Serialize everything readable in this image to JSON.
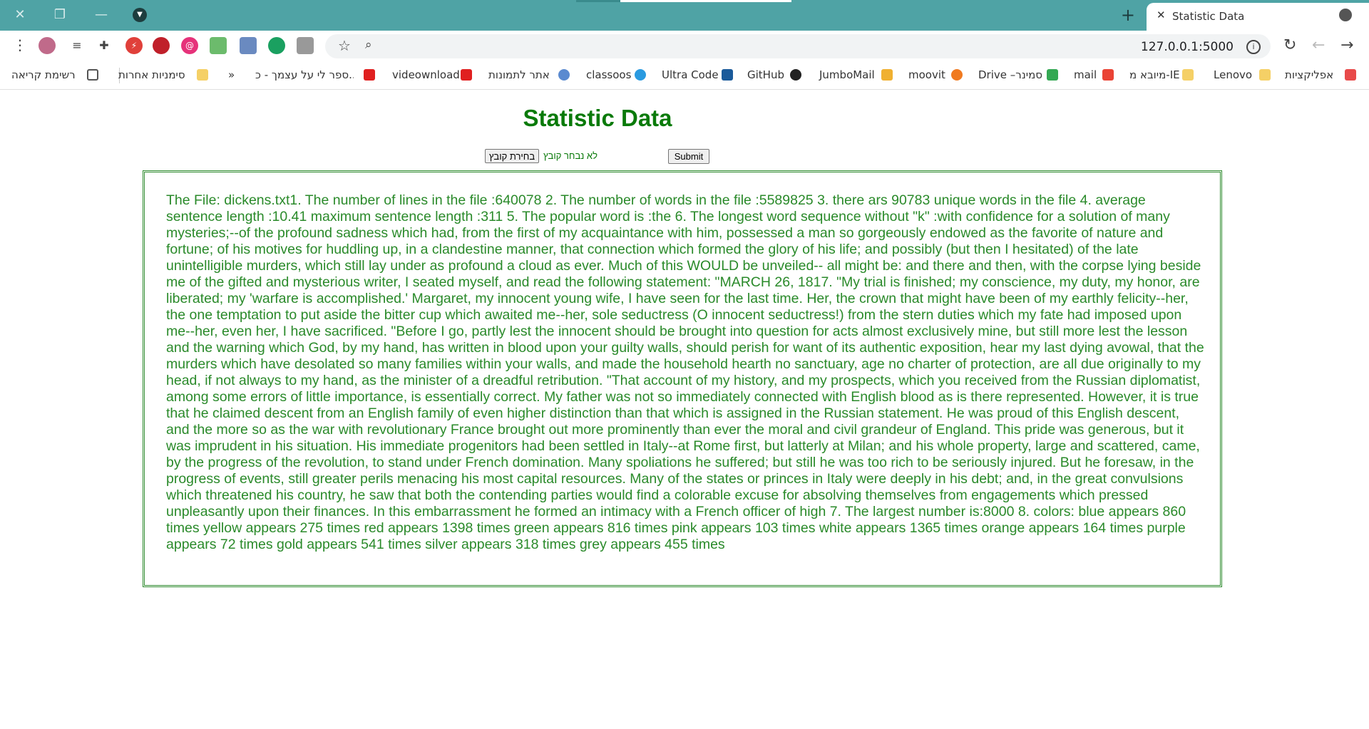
{
  "browser": {
    "tab_title": "Statistic Data",
    "tab_close": "✕",
    "new_tab": "+",
    "window_close": "✕",
    "window_restore": "❐",
    "window_minimize": "—",
    "url": "127.0.0.1:5000",
    "info": "i"
  },
  "bookmarks": {
    "reading_list": "רשימת קריאה",
    "other_bookmarks": "סימניות אחרות",
    "overflow": "»",
    "items": [
      "ספר לי על עצמך - כ...",
      "videownload",
      "אתר לתמונות",
      "classoos",
      "Ultra Code",
      "GitHub",
      "JumboMail",
      "moovit",
      "Drive –סמינר",
      "mail",
      "מיובא מ-IE",
      "Lenovo",
      "אפליקציות"
    ]
  },
  "page": {
    "title": "Statistic Data",
    "file_button": "בחירת קובץ",
    "file_status": "לא נבחר קובץ",
    "submit": "Submit",
    "result": "The File: dickens.txt1. The number of lines in the file :640078 2. The number of words in the file :5589825 3. there ars 90783 unique words in the file 4. average sentence length :10.41 maximum sentence length :311 5. The popular word is :the 6. The longest word sequence without \"k\" :with confidence for a solution of many mysteries;--of the profound sadness which had, from the first of my acquaintance with him, possessed a man so gorgeously endowed as the favorite of nature and fortune; of his motives for huddling up, in a clandestine manner, that connection which formed the glory of his life; and possibly (but then I hesitated) of the late unintelligible murders, which still lay under as profound a cloud as ever. Much of this WOULD be unveiled-- all might be: and there and then, with the corpse lying beside me of the gifted and mysterious writer, I seated myself, and read the following statement: \"MARCH 26, 1817. \"My trial is finished; my conscience, my duty, my honor, are liberated; my 'warfare is accomplished.' Margaret, my innocent young wife, I have seen for the last time. Her, the crown that might have been of my earthly felicity--her, the one temptation to put aside the bitter cup which awaited me--her, sole seductress (O innocent seductress!) from the stern duties which my fate had imposed upon me--her, even her, I have sacrificed. \"Before I go, partly lest the innocent should be brought into question for acts almost exclusively mine, but still more lest the lesson and the warning which God, by my hand, has written in blood upon your guilty walls, should perish for want of its authentic exposition, hear my last dying avowal, that the murders which have desolated so many families within your walls, and made the household hearth no sanctuary, age no charter of protection, are all due originally to my head, if not always to my hand, as the minister of a dreadful retribution. \"That account of my history, and my prospects, which you received from the Russian diplomatist, among some errors of little importance, is essentially correct. My father was not so immediately connected with English blood as is there represented. However, it is true that he claimed descent from an English family of even higher distinction than that which is assigned in the Russian statement. He was proud of this English descent, and the more so as the war with revolutionary France brought out more prominently than ever the moral and civil grandeur of England. This pride was generous, but it was imprudent in his situation. His immediate progenitors had been settled in Italy--at Rome first, but latterly at Milan; and his whole property, large and scattered, came, by the progress of the revolution, to stand under French domination. Many spoliations he suffered; but still he was too rich to be seriously injured. But he foresaw, in the progress of events, still greater perils menacing his most capital resources. Many of the states or princes in Italy were deeply in his debt; and, in the great convulsions which threatened his country, he saw that both the contending parties would find a colorable excuse for absolving themselves from engagements which pressed unpleasantly upon their finances. In this embarrassment he formed an intimacy with a French officer of high 7. The largest number is:8000 8. colors: blue appears 860 times yellow appears 275 times red appears 1398 times green appears 816 times pink appears 103 times white appears 1365 times orange appears 164 times purple appears 72 times gold appears 541 times silver appears 318 times grey appears 455 times"
  }
}
